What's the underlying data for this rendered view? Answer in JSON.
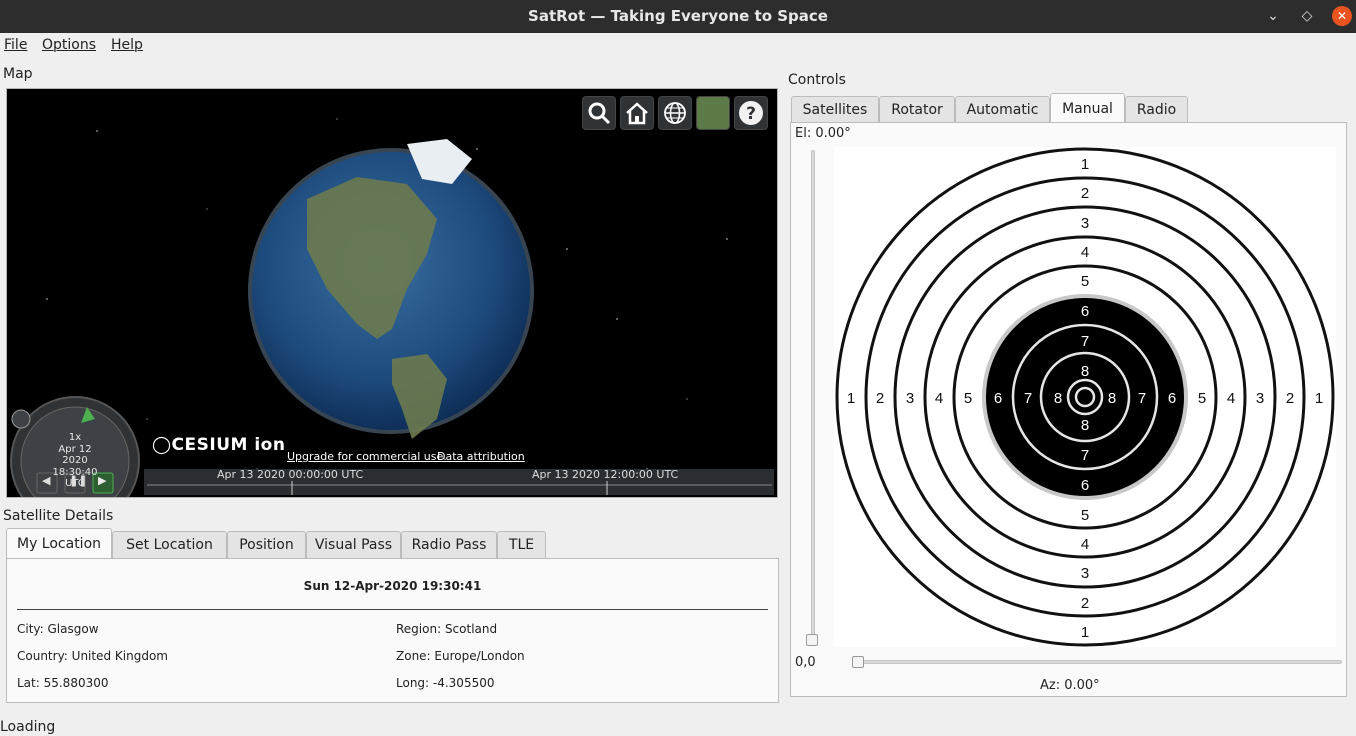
{
  "window": {
    "title": "SatRot —  Taking Everyone to Space"
  },
  "menu": {
    "file": "File",
    "options": "Options",
    "help": "Help"
  },
  "map": {
    "label": "Map",
    "logo": "CESIUM ion",
    "upgrade": "Upgrade for commercial use.",
    "attribution": "Data attribution",
    "speed": "1x",
    "date": "Apr 12 2020",
    "time": "18:30:40 UTC",
    "timeline": [
      "Apr 13 2020 00:00:00 UTC",
      "Apr 13 2020 12:00:00 UTC"
    ],
    "tools": [
      "search-icon",
      "home-icon",
      "globe-icon",
      "imagery-icon",
      "help-icon"
    ]
  },
  "details": {
    "label": "Satellite Details",
    "tabs": [
      "My Location",
      "Set Location",
      "Position",
      "Visual Pass",
      "Radio Pass",
      "TLE"
    ],
    "active_tab": "My Location",
    "datetime": "Sun 12-Apr-2020 19:30:41",
    "city": "City: Glasgow",
    "region": "Region: Scotland",
    "country": "Country: United Kingdom",
    "zone": "Zone: Europe/London",
    "lat": "Lat: 55.880300",
    "long": "Long: -4.305500"
  },
  "controls": {
    "label": "Controls",
    "tabs": [
      "Satellites",
      "Rotator",
      "Automatic",
      "Manual",
      "Radio"
    ],
    "active_tab": "Manual",
    "el": "El: 0.00°",
    "az": "Az: 0.00°",
    "origin": "0,0",
    "ring_numbers": [
      "1",
      "2",
      "3",
      "4",
      "5",
      "6",
      "7",
      "8"
    ]
  },
  "status": "Loading",
  "colors": {
    "titlebar": "#2d2d2d",
    "close": "#e95420",
    "timeline": "#2a2e33"
  }
}
